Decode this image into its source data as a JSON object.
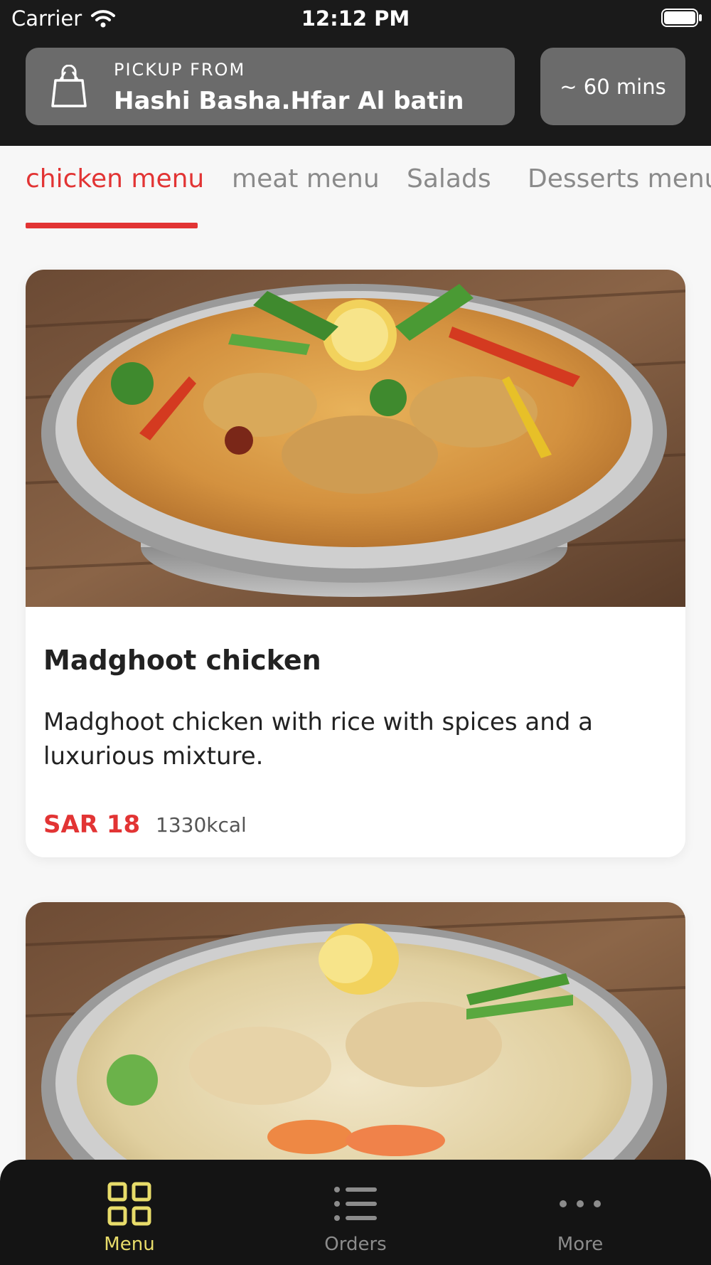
{
  "status_bar": {
    "carrier": "Carrier",
    "time": "12:12 PM"
  },
  "header": {
    "pickup_label": "PICKUP FROM",
    "pickup_location": "Hashi Basha.Hfar Al batin",
    "eta": "~ 60 mins",
    "icons": {
      "pickup": "shopping-bag-icon"
    }
  },
  "tabs": [
    {
      "label": "chicken menu",
      "active": true
    },
    {
      "label": "meat menu",
      "active": false
    },
    {
      "label": "Salads",
      "active": false
    },
    {
      "label": "Desserts menu",
      "active": false
    }
  ],
  "menu_items": [
    {
      "name": "Madghoot chicken",
      "description": "Madghoot chicken with rice with spices and a luxurious mixture.",
      "price": "SAR 18",
      "calories": "1330kcal"
    }
  ],
  "bottom_nav": [
    {
      "label": "Menu",
      "icon": "grid-icon",
      "active": true
    },
    {
      "label": "Orders",
      "icon": "list-icon",
      "active": false
    },
    {
      "label": "More",
      "icon": "more-dots-icon",
      "active": false
    }
  ],
  "colors": {
    "accent": "#e23434",
    "header_bg": "#1a1a1a",
    "header_card_bg": "#6b6b6b",
    "nav_active": "#e8dc6a",
    "nav_inactive": "#8c8c8c"
  }
}
